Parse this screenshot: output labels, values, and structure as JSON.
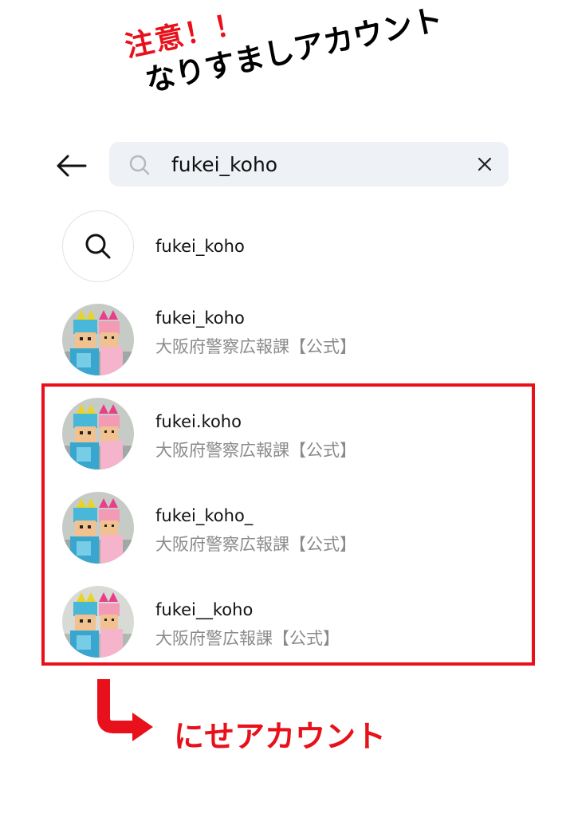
{
  "annotation": {
    "warning_title": "注意！！",
    "warning_subtitle": "なりすましアカウント",
    "fake_label": "にせアカウント"
  },
  "search": {
    "query": "fukei_koho",
    "back_icon": "arrow-left-icon",
    "search_icon": "magnifier-icon",
    "clear_icon": "close-icon"
  },
  "results": [
    {
      "type": "query",
      "name": "fukei_koho"
    },
    {
      "type": "account",
      "name": "fukei_koho",
      "subtitle": "大阪府警察広報課【公式】"
    },
    {
      "type": "account",
      "name": "fukei.koho",
      "subtitle": "大阪府警察広報課【公式】"
    },
    {
      "type": "account",
      "name": "fukei_koho_",
      "subtitle": "大阪府警察広報課【公式】"
    },
    {
      "type": "account",
      "name": "fukei__koho",
      "subtitle": "大阪府警広報課【公式】"
    }
  ],
  "colors": {
    "warning": "#e8101a",
    "search_bg": "#eef1f5",
    "subtitle": "#8b8b8b"
  }
}
